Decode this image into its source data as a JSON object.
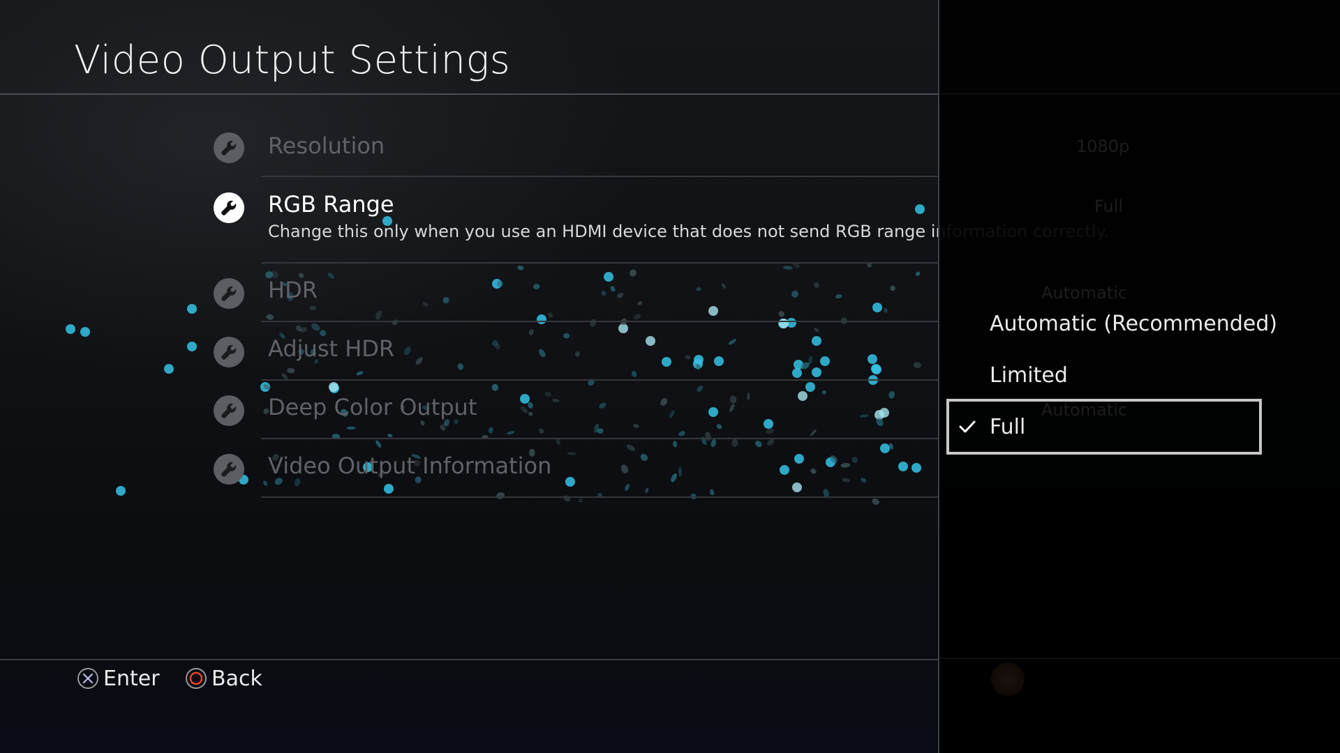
{
  "header": {
    "title": "Video Output Settings"
  },
  "menu": {
    "items": [
      {
        "label": "Resolution",
        "icon": "wrench-icon",
        "active": false
      },
      {
        "label": "RGB Range",
        "icon": "wrench-icon",
        "active": true,
        "description": "Change this only when you use an HDMI device that does not send RGB range information correctly."
      },
      {
        "label": "HDR",
        "icon": "wrench-icon",
        "active": false
      },
      {
        "label": "Adjust HDR",
        "icon": "wrench-icon",
        "active": false
      },
      {
        "label": "Deep Color Output",
        "icon": "wrench-icon",
        "active": false
      },
      {
        "label": "Video Output Information",
        "icon": "wrench-icon",
        "active": false
      }
    ]
  },
  "panel": {
    "ghost_values": [
      "1080p",
      "Full",
      "Automatic",
      "Automatic"
    ],
    "options": [
      {
        "label": "Automatic (Recommended)",
        "selected": false
      },
      {
        "label": "Limited",
        "selected": false
      },
      {
        "label": "Full",
        "selected": true,
        "icon": "checkmark-icon"
      }
    ]
  },
  "footer": {
    "enter": {
      "label": "Enter",
      "icon": "cross-button-icon"
    },
    "back": {
      "label": "Back",
      "icon": "circle-button-icon"
    }
  },
  "colors": {
    "accent_particle": "#35c3e6",
    "circle_button": "#e0442c",
    "selection_border": "#c8c8c8"
  }
}
